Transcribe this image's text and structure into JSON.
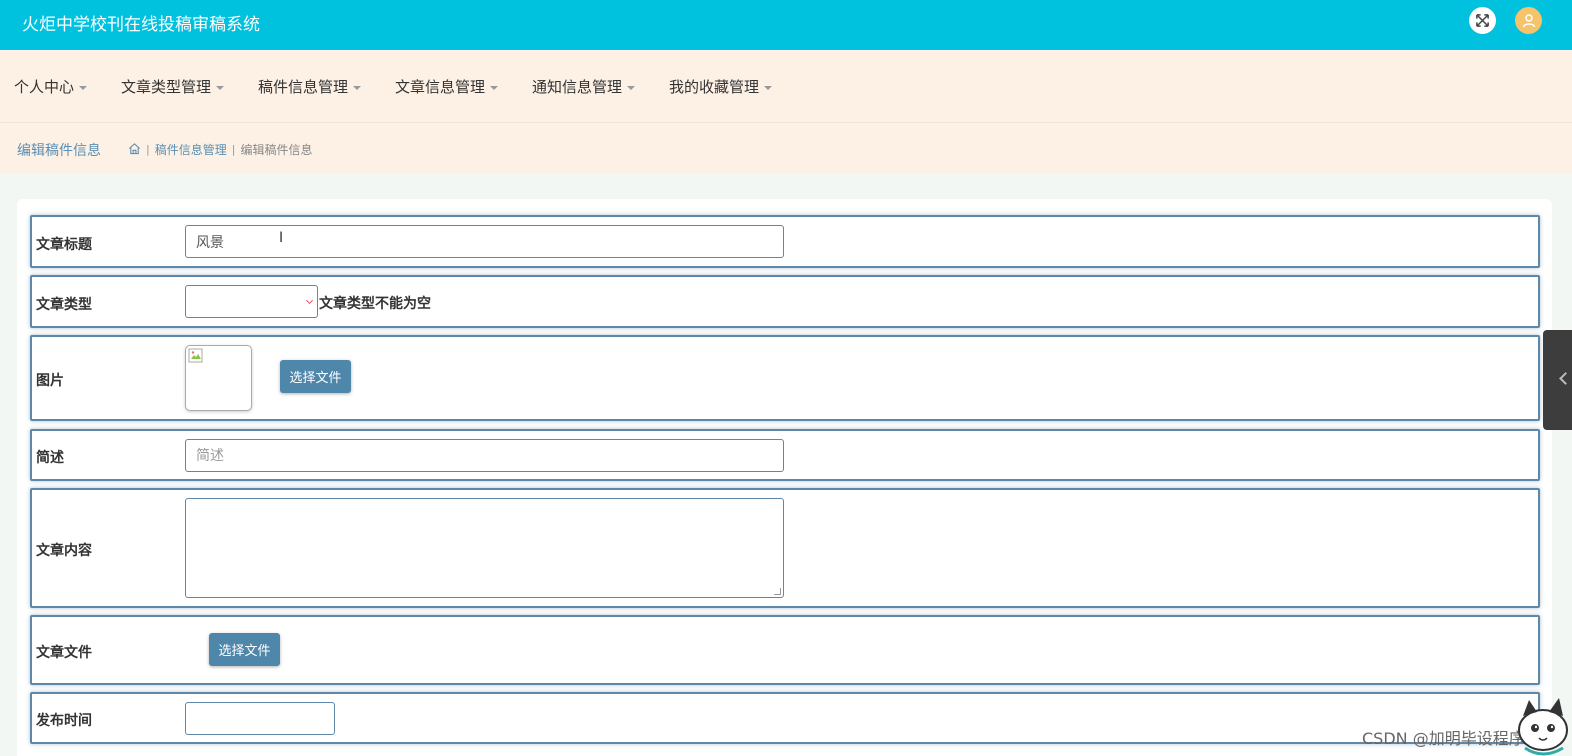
{
  "header": {
    "title": "火炬中学校刊在线投稿审稿系统"
  },
  "nav": {
    "items": [
      {
        "label": "个人中心"
      },
      {
        "label": "文章类型管理"
      },
      {
        "label": "稿件信息管理"
      },
      {
        "label": "文章信息管理"
      },
      {
        "label": "通知信息管理"
      },
      {
        "label": "我的收藏管理"
      }
    ]
  },
  "page": {
    "title": "编辑稿件信息",
    "breadcrumbs": [
      "稿件信息管理",
      "编辑稿件信息"
    ]
  },
  "form": {
    "title": {
      "label": "文章标题",
      "value": "风景"
    },
    "type": {
      "label": "文章类型",
      "error": "文章类型不能为空"
    },
    "image": {
      "label": "图片",
      "button": "选择文件"
    },
    "summary": {
      "label": "简述",
      "placeholder": "简述"
    },
    "content": {
      "label": "文章内容"
    },
    "file": {
      "label": "文章文件",
      "button": "选择文件"
    },
    "publish_time": {
      "label": "发布时间"
    }
  },
  "watermark": "CSDN @加明毕设程序",
  "colors": {
    "header": "#00c1de",
    "nav_bg": "#fdf1e5",
    "button": "#4f87ab",
    "field_border": "#5f87a8"
  }
}
